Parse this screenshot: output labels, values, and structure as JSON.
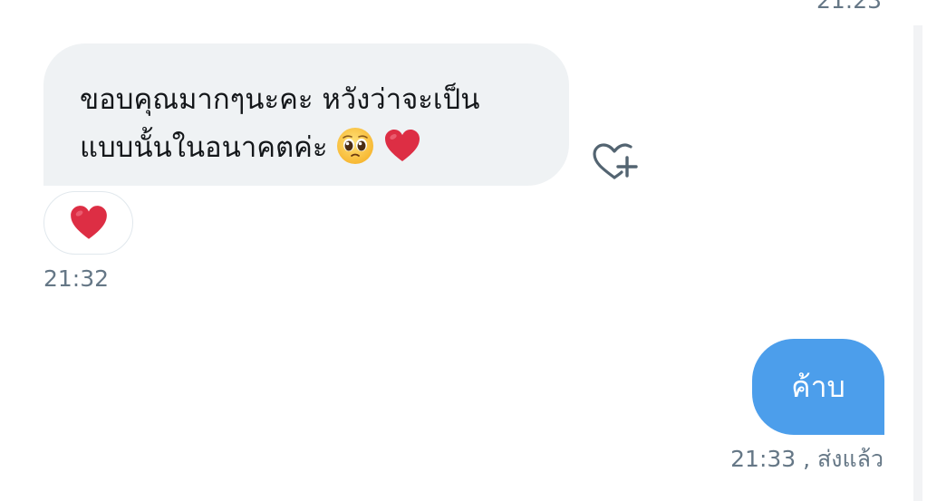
{
  "conversation": {
    "top_timestamp": "21:23",
    "received_message": {
      "lines": [
        "ขอบคุณมากๆนะคะ หวังว่าจะเป็น",
        "แบบนั้นในอนาคตค่ะ"
      ],
      "emojis": [
        "pleading-face-icon",
        "red-heart-icon"
      ],
      "reaction": "red-heart-icon",
      "timestamp": "21:32"
    },
    "sent_message": {
      "text": "ค้าบ",
      "timestamp": "21:33",
      "status": ", ส่งแล้ว"
    }
  },
  "colors": {
    "received_bubble": "#eff2f4",
    "sent_bubble": "#4c9eeb",
    "timestamp_text": "#657786",
    "heart": "#e0245e"
  }
}
